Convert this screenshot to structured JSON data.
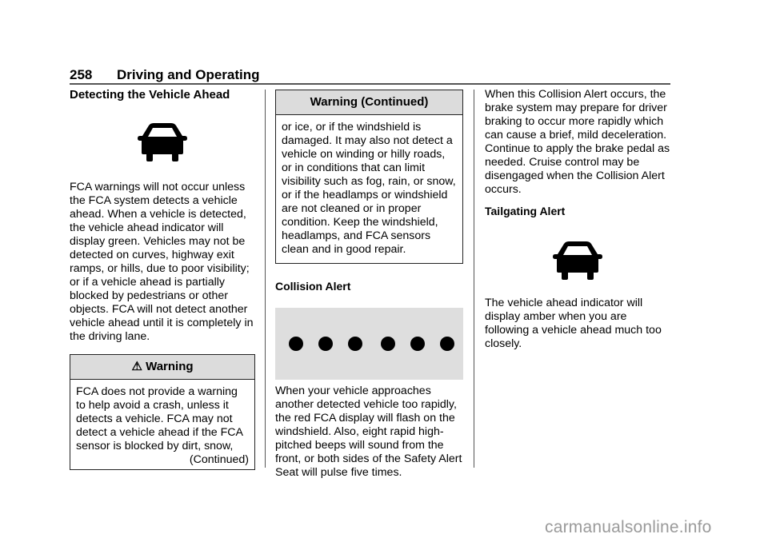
{
  "header": {
    "page_number": "258",
    "chapter": "Driving and Operating"
  },
  "column1": {
    "title": "Detecting the Vehicle Ahead",
    "icon": "vehicle-ahead-icon",
    "paragraph": "FCA warnings will not occur unless the FCA system detects a vehicle ahead. When a vehicle is detected, the vehicle ahead indicator will display green. Vehicles may not be detected on curves, highway exit ramps, or hills, due to poor visibility; or if a vehicle ahead is partially blocked by pedestrians or other objects. FCA will not detect another vehicle ahead until it is completely in the driving lane.",
    "warning": {
      "icon": "warning-triangle-icon",
      "title": "Warning",
      "body": "FCA does not provide a warning to help avoid a crash, unless it detects a vehicle. FCA may not detect a vehicle ahead if the FCA sensor is blocked by dirt, snow,",
      "continued": "(Continued)"
    }
  },
  "column2": {
    "warning_continued": {
      "title": "Warning  (Continued)",
      "body": "or ice, or if the windshield is damaged. It may also not detect a vehicle on winding or hilly roads, or in conditions that can limit visibility such as fog, rain, or snow, or if the headlamps or windshield are not cleaned or in proper condition. Keep the windshield, headlamps, and FCA sensors clean and in good repair."
    },
    "subheading": "Collision Alert",
    "alert_dots": 6,
    "paragraph": "When your vehicle approaches another detected vehicle too rapidly, the red FCA display will flash on the windshield. Also, eight rapid high-pitched beeps will sound from the front, or both sides of the Safety Alert Seat will pulse five times."
  },
  "column3": {
    "paragraph1": "When this Collision Alert occurs, the brake system may prepare for driver braking to occur more rapidly which can cause a brief, mild deceleration. Continue to apply the brake pedal as needed. Cruise control may be disengaged when the Collision Alert occurs.",
    "subheading": "Tailgating Alert",
    "icon": "vehicle-ahead-icon",
    "paragraph2": "The vehicle ahead indicator will display amber when you are following a vehicle ahead much too closely."
  },
  "watermark": "carmanualsonline.info"
}
